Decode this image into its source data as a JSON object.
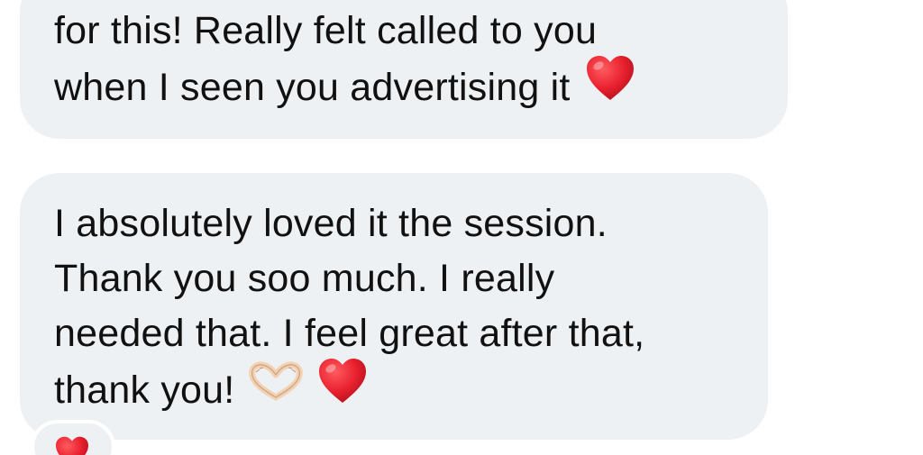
{
  "messages": [
    {
      "lines": [
        "for this! Really felt called to you",
        "when I seen you advertising it"
      ],
      "trailing_emoji": [
        "red-heart"
      ]
    },
    {
      "lines": [
        "I absolutely loved it the session.",
        "Thank you soo much. I really",
        "needed that. I feel great after that,",
        "thank you!"
      ],
      "trailing_emoji": [
        "heart-hands",
        "red-heart"
      ]
    }
  ],
  "reaction": {
    "emoji": "red-heart"
  },
  "colors": {
    "bubble_background": "#eef1f4",
    "text": "#111111",
    "heart": "#e8202e",
    "heart_hands_skin": "#f3d2b3"
  }
}
